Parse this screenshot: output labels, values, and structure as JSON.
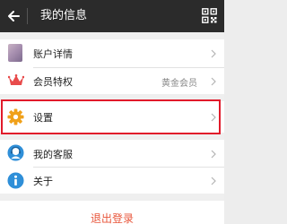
{
  "header": {
    "title": "我的信息"
  },
  "menu": {
    "account": {
      "label": "账户详情"
    },
    "vip": {
      "label": "会员特权",
      "value": "黄金会员"
    },
    "settings": {
      "label": "设置"
    },
    "service": {
      "label": "我的客服"
    },
    "about": {
      "label": "关于"
    }
  },
  "logout": {
    "label": "退出登录"
  },
  "icons": {
    "back": "arrow-left-icon",
    "qr": "qr-code-icon",
    "account": "avatar-icon",
    "vip": "crown-icon",
    "settings": "gear-icon",
    "service": "customer-service-icon",
    "about": "info-icon",
    "chevron": "chevron-right-icon"
  },
  "colors": {
    "header_bg": "#2b2b2b",
    "crown": "#e84b4b",
    "gear": "#f0a11a",
    "service": "#2f8fd8",
    "info": "#2f8fd8",
    "highlight_border": "#e11a2a",
    "logout_text": "#e8563b"
  }
}
